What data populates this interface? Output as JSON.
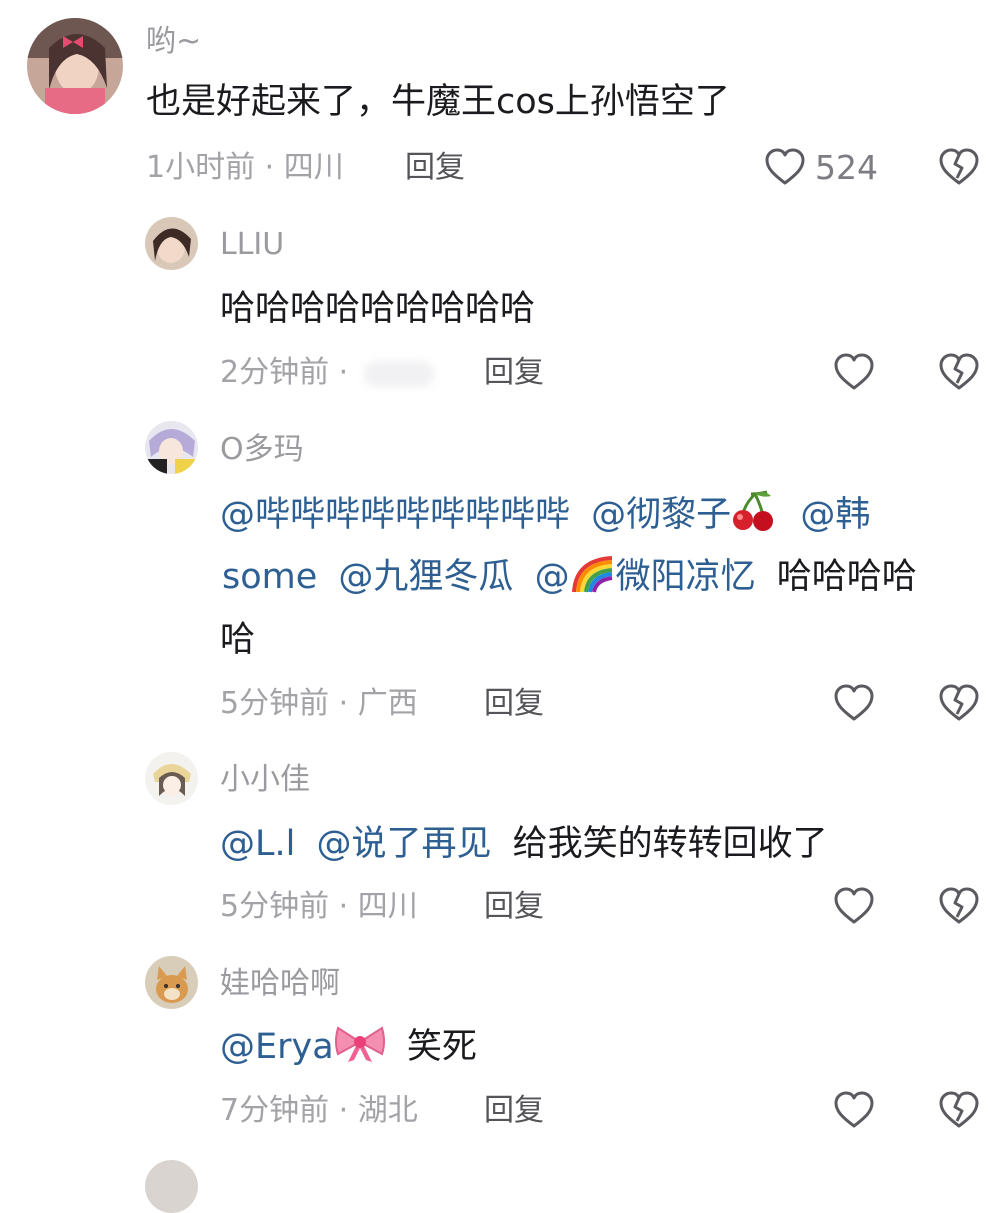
{
  "comments": [
    {
      "username": "哟~",
      "text": "也是好起来了，牛魔王cos上孙悟空了",
      "time": "1小时前",
      "location": "四川",
      "reply_label": "回复",
      "like_count": "524"
    },
    {
      "username": "LLIU",
      "text": "哈哈哈哈哈哈哈哈哈",
      "time": "2分钟前",
      "location": "",
      "reply_label": "回复"
    },
    {
      "username": "O多玛",
      "mentions": [
        "@哔哔哔哔哔哔哔哔哔",
        "@彻黎子",
        "@韩",
        "some",
        "@九狸冬瓜",
        "@",
        "微阳凉忆"
      ],
      "tail": "哈哈哈哈",
      "tail2": "哈",
      "time": "5分钟前",
      "location": "广西",
      "reply_label": "回复"
    },
    {
      "username": "小小佳",
      "mentions": [
        "@L.l",
        "@说了再见"
      ],
      "tail": "给我笑的转转回收了",
      "time": "5分钟前",
      "location": "四川",
      "reply_label": "回复"
    },
    {
      "username": "娃哈哈啊",
      "mentions": [
        "@Erya"
      ],
      "tail": "笑死",
      "time": "7分钟前",
      "location": "湖北",
      "reply_label": "回复"
    }
  ],
  "meta_separator": "·",
  "icons": {
    "like": "heart-outline-icon",
    "dislike": "broken-heart-icon",
    "cherry": "cherry-emoji",
    "rainbow": "rainbow-emoji",
    "bow": "ribbon-bow-emoji"
  },
  "colors": {
    "mention": "#2e5f93",
    "text": "#1b1b1f",
    "meta": "#a2a2a7"
  }
}
